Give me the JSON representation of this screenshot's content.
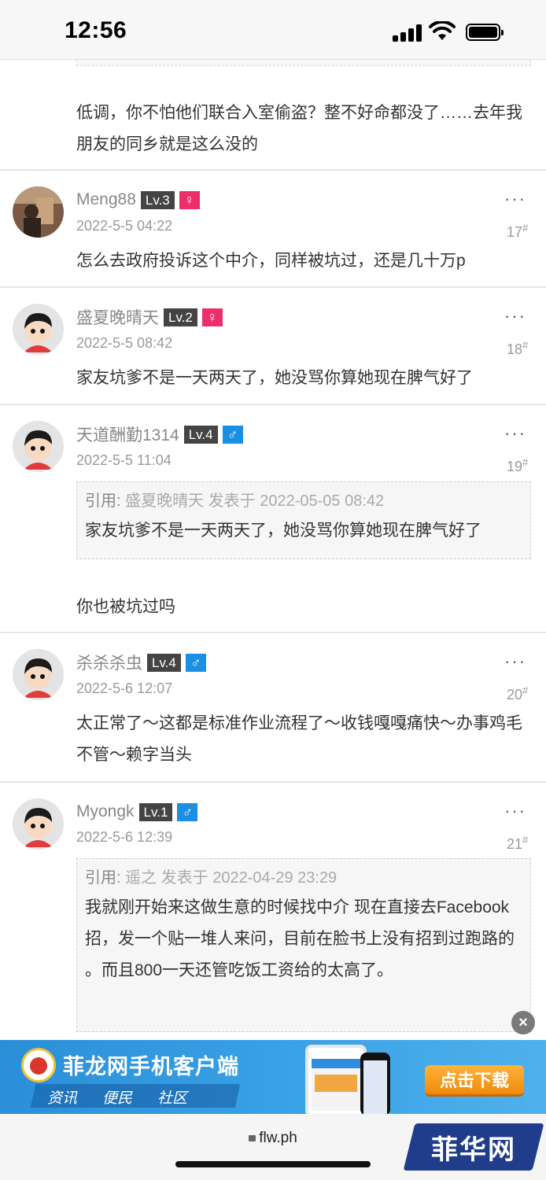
{
  "status": {
    "time": "12:56"
  },
  "posts": [
    {
      "text": "低调，你不怕他们联合入室偷盗？整不好命都没了……去年我朋友的同乡就是这么没的"
    },
    {
      "user": "Meng88",
      "level": "Lv.3",
      "sex": "♀",
      "date": "2022-5-5 04:22",
      "floor": "17",
      "more": "···",
      "text": "怎么去政府投诉这个中介，同样被坑过，还是几十万p"
    },
    {
      "user": "盛夏晚晴天",
      "level": "Lv.2",
      "sex": "♀",
      "date": "2022-5-5 08:42",
      "floor": "18",
      "more": "···",
      "text": "家友坑爹不是一天两天了，她没骂你算她现在脾气好了"
    },
    {
      "user": "天道酬勤1314",
      "level": "Lv.4",
      "sex": "♂",
      "date": "2022-5-5 11:04",
      "floor": "19",
      "more": "···",
      "quote_label": "引用:",
      "quote_meta": "盛夏晚晴天 发表于 2022-05-05 08:42",
      "quote_text": "家友坑爹不是一天两天了，她没骂你算她现在脾气好了",
      "text": "你也被坑过吗"
    },
    {
      "user": "杀杀杀虫",
      "level": "Lv.4",
      "sex": "♂",
      "date": "2022-5-6 12:07",
      "floor": "20",
      "more": "···",
      "text": "太正常了～这都是标准作业流程了～收钱嘎嘎痛快～办事鸡毛不管～赖字当头"
    },
    {
      "user": "Myongk",
      "level": "Lv.1",
      "sex": "♂",
      "date": "2022-5-6 12:39",
      "floor": "21",
      "more": "···",
      "quote_label": "引用:",
      "quote_meta": "遥之 发表于 2022-04-29 23:29",
      "quote_text": "我就刚开始来这做生意的时候找中介 现在直接去Facebook招，发一个贴一堆人来问，目前在脸书上没有招到过跑路的 。而且800一天还管吃饭工资给的太高了。"
    }
  ],
  "ad": {
    "title": "菲龙网手机客户端",
    "tabs": [
      "资讯",
      "便民",
      "社区"
    ],
    "button": "点击下载",
    "close": "×"
  },
  "browser": {
    "url": "flw.ph"
  },
  "watermark": {
    "text": "菲华网"
  },
  "colors": {
    "female": "#ee2e6a",
    "male": "#1a8fe3",
    "level_bg": "#444444",
    "ad_bg": "#3aa2e6",
    "ad_button": "#f08a0c"
  }
}
